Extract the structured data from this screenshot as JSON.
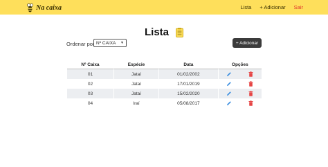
{
  "navbar": {
    "brand": "Na caixa",
    "icon": "bee-icon",
    "links": [
      "Lista",
      "+ Adicionar",
      "Sair"
    ],
    "colors": {
      "background": "#fedf5b",
      "logout": "#e0332b"
    }
  },
  "main": {
    "title": "Lista",
    "title_icon": "notepad-icon",
    "sort": {
      "label": "Ordenar por",
      "selected": "Nº CAIXA"
    },
    "add_button": "+ Adicionar"
  },
  "table": {
    "headers": [
      "Nº Caixa",
      "Espécie",
      "Data",
      "Opções"
    ],
    "rows": [
      {
        "box": "01",
        "species": "Jataí",
        "date": "01/02/2002"
      },
      {
        "box": "02",
        "species": "Jataí",
        "date": "17/01/2019"
      },
      {
        "box": "03",
        "species": "Jataí",
        "date": "15/02/2020"
      },
      {
        "box": "04",
        "species": "Iraí",
        "date": "05/08/2017"
      }
    ],
    "row_icons": [
      "pencil-icon",
      "trash-icon"
    ],
    "colors": {
      "edit": "#3d8fe0",
      "delete": "#e64545"
    }
  }
}
